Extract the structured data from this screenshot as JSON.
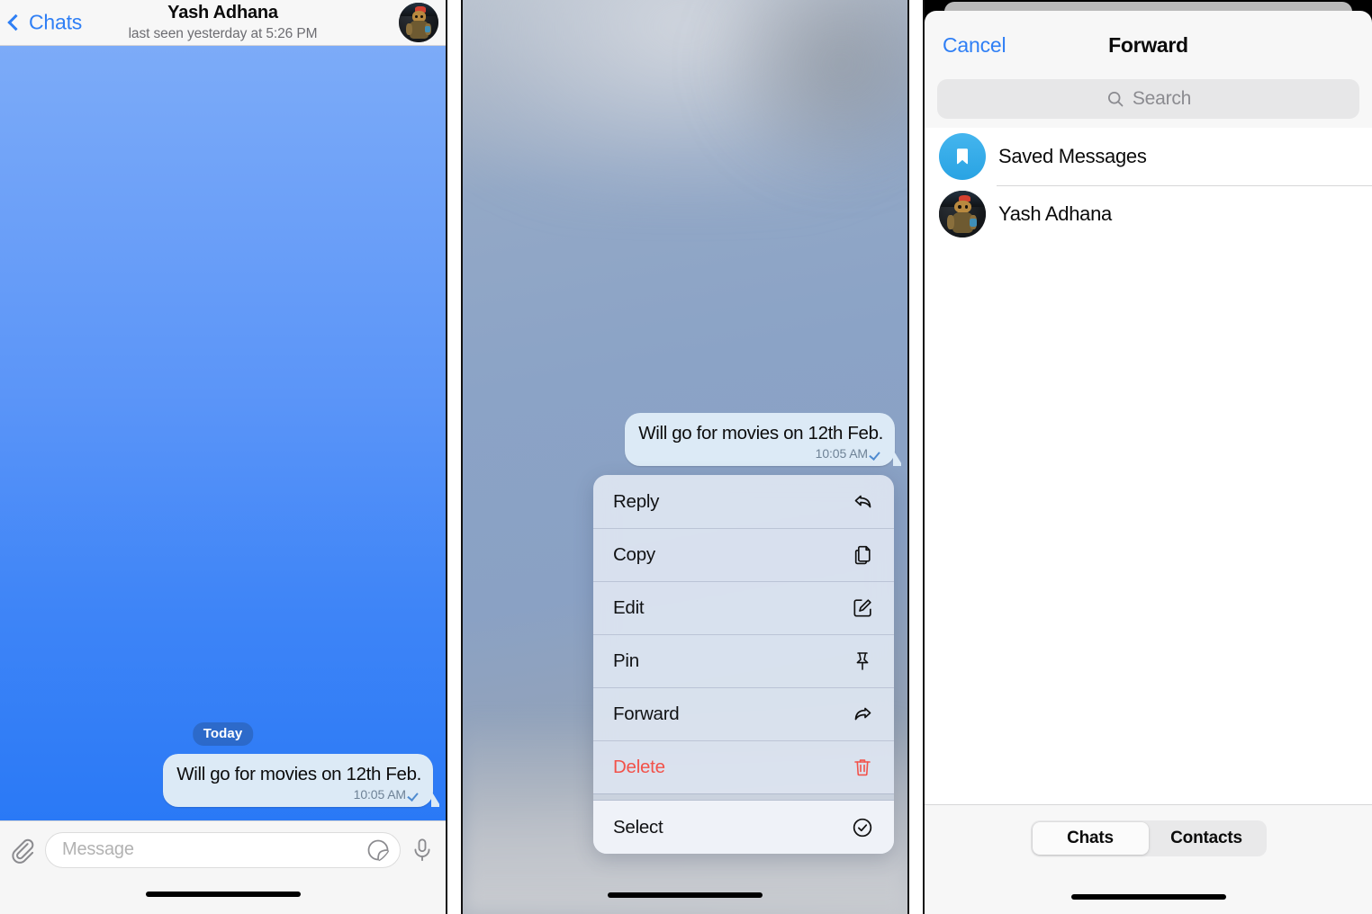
{
  "panel1": {
    "name": "telegram-chat-screen",
    "navbar": {
      "back_label": "Chats",
      "back_icon": "chevron-left-icon",
      "title": "Yash Adhana",
      "subtitle": "last seen yesterday at 5:26 PM",
      "avatar_icon": "contact-avatar"
    },
    "date_separator": "Today",
    "message": {
      "text": "Will go for movies on 12th Feb.",
      "time": "10:05 AM",
      "status_icon": "single-check-icon"
    },
    "input_bar": {
      "attach_icon": "paperclip-icon",
      "placeholder": "Message",
      "sticker_icon": "sticker-icon",
      "mic_icon": "microphone-icon"
    }
  },
  "panel2": {
    "name": "message-context-menu-screen",
    "message": {
      "text": "Will go for movies on 12th Feb.",
      "time": "10:05 AM",
      "status_icon": "single-check-icon"
    },
    "menu_items": [
      {
        "label": "Reply",
        "icon": "reply-arrow-icon",
        "danger": false
      },
      {
        "label": "Copy",
        "icon": "copy-pages-icon",
        "danger": false
      },
      {
        "label": "Edit",
        "icon": "edit-pencil-icon",
        "danger": false
      },
      {
        "label": "Pin",
        "icon": "pin-icon",
        "danger": false
      },
      {
        "label": "Forward",
        "icon": "forward-arrow-icon",
        "danger": false
      },
      {
        "label": "Delete",
        "icon": "trash-icon",
        "danger": true
      },
      {
        "label": "Select",
        "icon": "check-circle-icon",
        "danger": false
      }
    ]
  },
  "panel3": {
    "name": "forward-sheet-screen",
    "nav": {
      "cancel_label": "Cancel",
      "title": "Forward"
    },
    "search": {
      "placeholder": "Search",
      "icon": "search-icon"
    },
    "rows": [
      {
        "label": "Saved Messages",
        "avatar": "saved-messages-bookmark-icon"
      },
      {
        "label": "Yash Adhana",
        "avatar": "contact-avatar"
      }
    ],
    "segments": [
      {
        "label": "Chats",
        "active": true
      },
      {
        "label": "Contacts",
        "active": false
      }
    ]
  },
  "colors": {
    "accent_blue": "#2f7ff5",
    "danger_red": "#f2524a",
    "bubble_bg": "#dceaf6",
    "saved_icon_blue": "#29a3e3",
    "chat_gradient_top": "#7cabf8",
    "chat_gradient_bottom": "#2a79f6"
  }
}
